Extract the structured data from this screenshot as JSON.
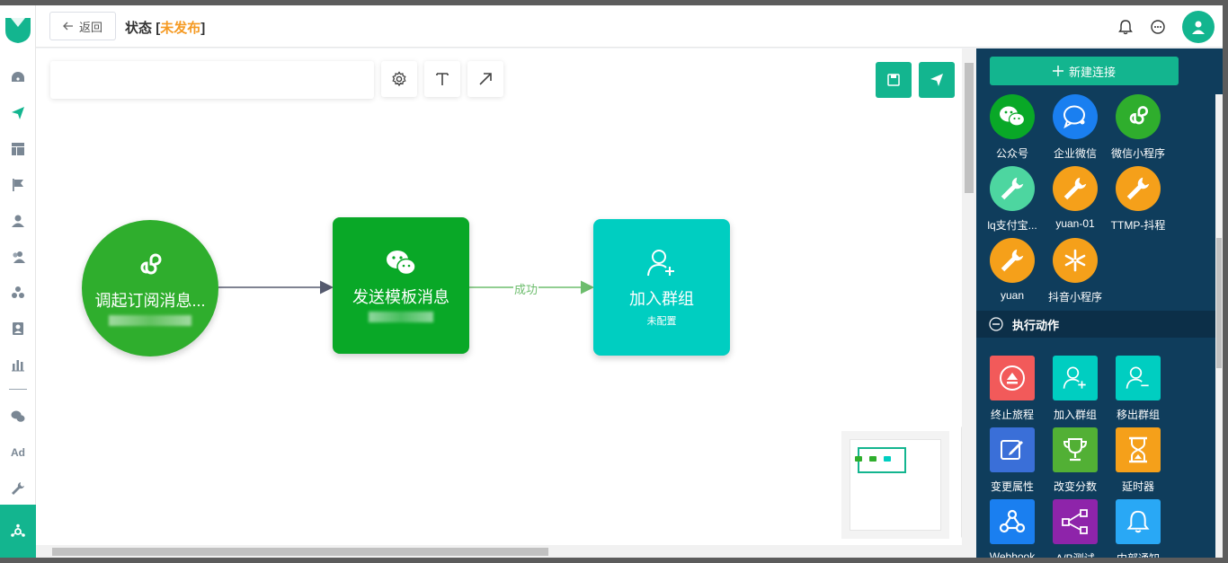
{
  "header": {
    "back_label": "返回",
    "status_label": "状态",
    "bracket_open": "[",
    "status_value": "未发布",
    "bracket_close": "]"
  },
  "flow": {
    "nodes": [
      {
        "title": "调起订阅消息...",
        "subtitle": ""
      },
      {
        "title": "发送模板消息",
        "subtitle": ""
      },
      {
        "title": "加入群组",
        "subtitle": "未配置"
      }
    ],
    "edge_label": "成功"
  },
  "right_panel": {
    "new_connection_label": "新建连接",
    "connections": [
      {
        "label": "公众号",
        "icon": "wechat-icon",
        "color": "#09a827"
      },
      {
        "label": "企业微信",
        "icon": "work-wechat-icon",
        "color": "#1a7ff0"
      },
      {
        "label": "微信小程序",
        "icon": "mini-program-icon",
        "color": "#2fae2d"
      },
      {
        "label": "lq支付宝...",
        "icon": "wrench-icon",
        "color": "#4dd6a0"
      },
      {
        "label": "yuan-01",
        "icon": "wrench-icon",
        "color": "#f5a01a"
      },
      {
        "label": "TTMP-抖程",
        "icon": "wrench-icon",
        "color": "#f5a01a"
      },
      {
        "label": "yuan",
        "icon": "wrench-icon",
        "color": "#f5a01a"
      },
      {
        "label": "抖音小程序",
        "icon": "asterisk-icon",
        "color": "#f5a01a"
      }
    ],
    "actions_section_label": "执行动作",
    "actions": [
      {
        "label": "终止旅程",
        "icon": "eject-icon",
        "color": "#f25a5a"
      },
      {
        "label": "加入群组",
        "icon": "user-add-icon",
        "color": "#00cec1"
      },
      {
        "label": "移出群组",
        "icon": "user-remove-icon",
        "color": "#00cec1"
      },
      {
        "label": "变更属性",
        "icon": "edit-icon",
        "color": "#3a6fd8"
      },
      {
        "label": "改变分数",
        "icon": "trophy-icon",
        "color": "#52b035"
      },
      {
        "label": "延时器",
        "icon": "hourglass-icon",
        "color": "#f5a01a"
      },
      {
        "label": "Webhook",
        "icon": "webhook-icon",
        "color": "#1a7ff0"
      },
      {
        "label": "A/B测试",
        "icon": "ab-test-icon",
        "color": "#8e24aa"
      },
      {
        "label": "内部通知",
        "icon": "bell-icon",
        "color": "#29a8f5"
      }
    ]
  },
  "colors": {
    "brand": "#13b58f",
    "status": "#f59a23",
    "panel": "#0f3d5c"
  }
}
